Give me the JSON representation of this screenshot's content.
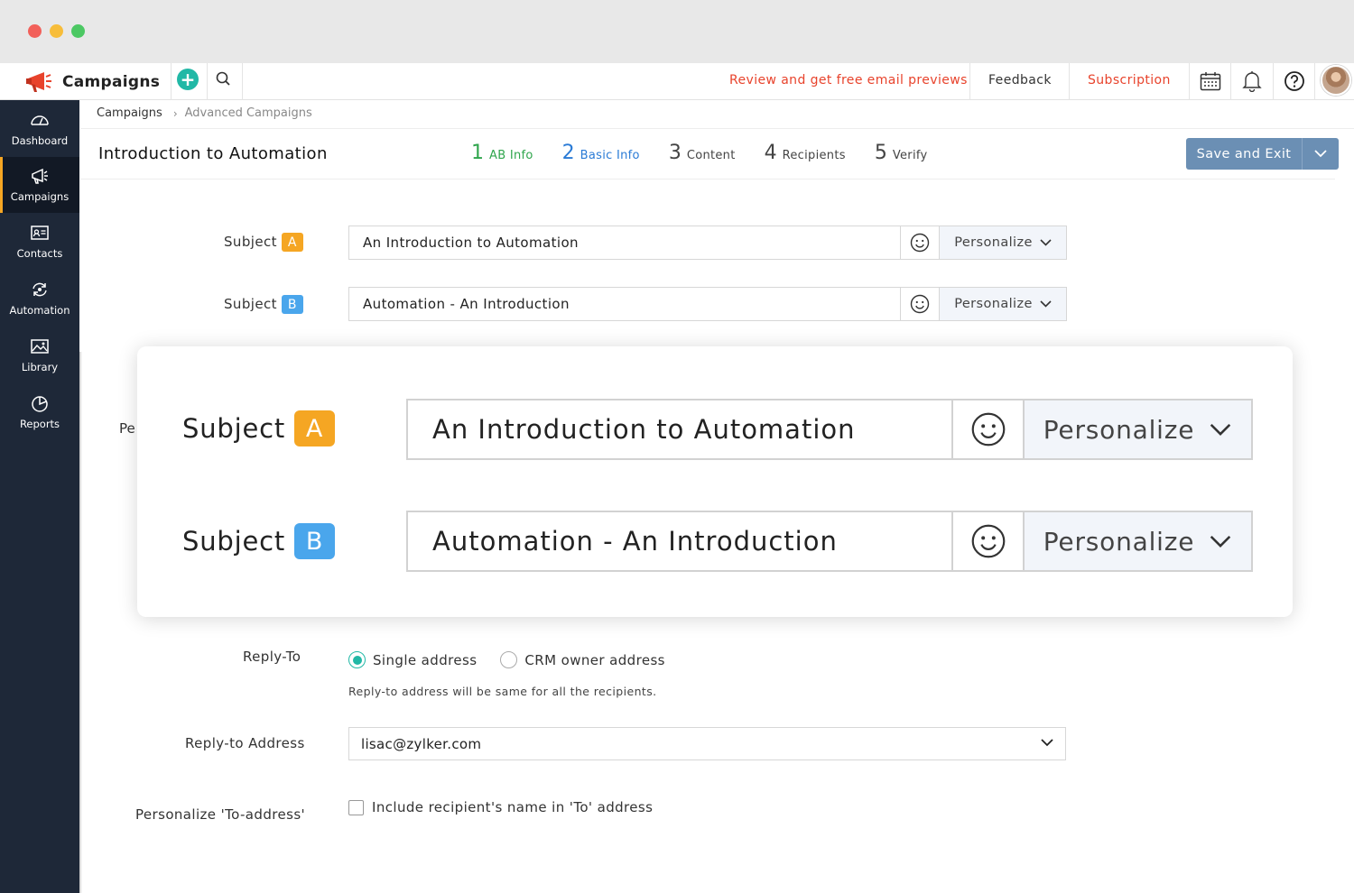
{
  "app": {
    "name": "Campaigns"
  },
  "topbar": {
    "review_link": "Review and get free email previews",
    "feedback": "Feedback",
    "subscription": "Subscription",
    "icons": [
      "plus-icon",
      "search-icon",
      "calendar-icon",
      "bell-icon",
      "help-icon"
    ]
  },
  "sidebar": {
    "items": [
      {
        "label": "Dashboard",
        "icon": "dashboard-icon"
      },
      {
        "label": "Campaigns",
        "icon": "megaphone-icon",
        "active": true
      },
      {
        "label": "Contacts",
        "icon": "contacts-icon"
      },
      {
        "label": "Automation",
        "icon": "automation-icon"
      },
      {
        "label": "Library",
        "icon": "image-icon"
      },
      {
        "label": "Reports",
        "icon": "pie-chart-icon"
      }
    ]
  },
  "breadcrumb": {
    "root": "Campaigns",
    "current": "Advanced Campaigns"
  },
  "header": {
    "title": "Introduction to Automation",
    "steps": [
      {
        "num": "1",
        "label": "AB Info",
        "state": "done"
      },
      {
        "num": "2",
        "label": "Basic Info",
        "state": "current"
      },
      {
        "num": "3",
        "label": "Content",
        "state": "pending"
      },
      {
        "num": "4",
        "label": "Recipients",
        "state": "pending"
      },
      {
        "num": "5",
        "label": "Verify",
        "state": "pending"
      }
    ],
    "save_label": "Save and Exit"
  },
  "form": {
    "subject_label": "Subject",
    "subject_a": {
      "badge": "A",
      "value": "An Introduction to Automation"
    },
    "subject_b": {
      "badge": "B",
      "value": "Automation - An Introduction"
    },
    "personalize": "Personalize",
    "partial_label": "Pe",
    "reply_to": {
      "label": "Reply-To",
      "options": [
        "Single address",
        "CRM owner address"
      ],
      "selected": "Single address",
      "hint": "Reply-to address will be same for all the recipients."
    },
    "reply_to_address": {
      "label": "Reply-to Address",
      "value": "lisac@zylker.com"
    },
    "personalize_to": {
      "label": "Personalize 'To-address'",
      "checkbox_label": "Include recipient's name in 'To' address",
      "checked": false
    }
  },
  "colors": {
    "accent": "#21b8a6",
    "orange": "#f5a623",
    "blue": "#4aa6ec",
    "link_red": "#e8432c",
    "sidebar": "#1e2838",
    "button": "#6b8fb4"
  }
}
